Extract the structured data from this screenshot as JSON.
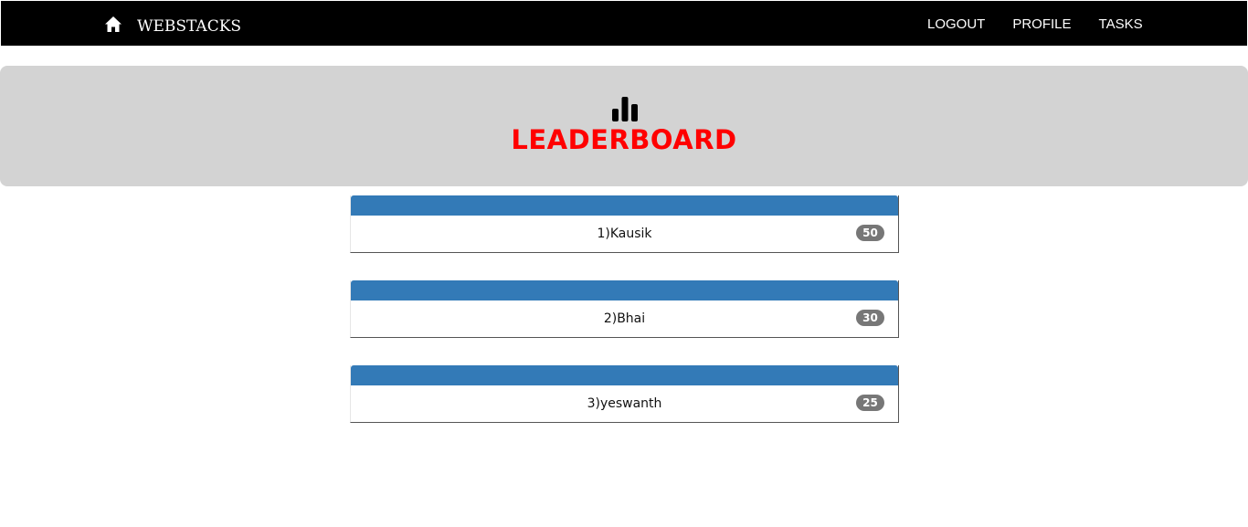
{
  "navbar": {
    "home_icon": "home-icon",
    "brand": "WEBSTACKS",
    "links": [
      "LOGOUT",
      "PROFILE",
      "TASKS"
    ]
  },
  "header": {
    "icon": "bar-chart-icon",
    "title": "LEADERBOARD"
  },
  "leaderboard": {
    "entries": [
      {
        "label": "1)Kausik",
        "score": "50"
      },
      {
        "label": "2)Bhai",
        "score": "30"
      },
      {
        "label": "3)yeswanth",
        "score": "25"
      }
    ]
  },
  "colors": {
    "navbar_bg": "#000000",
    "jumbotron_bg": "#d3d3d3",
    "title": "#ff0000",
    "panel_header": "#337ab7",
    "badge": "#777777"
  }
}
